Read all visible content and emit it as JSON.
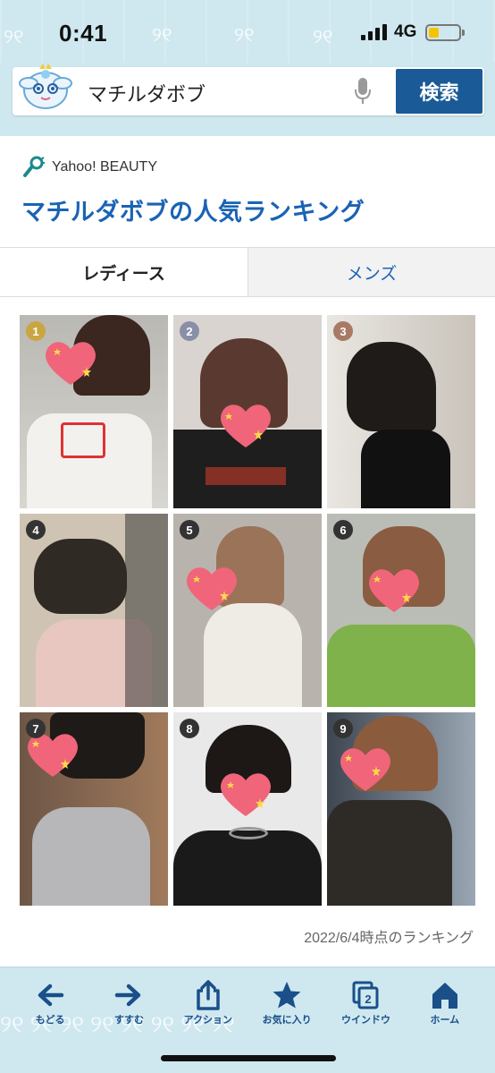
{
  "status_bar": {
    "time": "0:41",
    "network": "4G"
  },
  "search": {
    "query": "マチルダボブ",
    "button_label": "検索"
  },
  "header": {
    "brand": "Yahoo! BEAUTY",
    "title": "マチルダボブの人気ランキング"
  },
  "tabs": [
    {
      "label": "レディース",
      "selected": true
    },
    {
      "label": "メンズ",
      "selected": false
    }
  ],
  "ranking": {
    "items": [
      {
        "rank": "1",
        "badge_color": "#c9a640"
      },
      {
        "rank": "2",
        "badge_color": "#8a8fa8"
      },
      {
        "rank": "3",
        "badge_color": "#a87a66"
      },
      {
        "rank": "4",
        "badge_color": "#333333"
      },
      {
        "rank": "5",
        "badge_color": "#333333"
      },
      {
        "rank": "6",
        "badge_color": "#333333"
      },
      {
        "rank": "7",
        "badge_color": "#333333"
      },
      {
        "rank": "8",
        "badge_color": "#333333"
      },
      {
        "rank": "9",
        "badge_color": "#333333"
      }
    ],
    "date_note": "2022/6/4時点のランキング"
  },
  "bottom_nav": [
    {
      "label": "もどる",
      "icon": "back-arrow-icon"
    },
    {
      "label": "すすむ",
      "icon": "forward-arrow-icon"
    },
    {
      "label": "アクション",
      "icon": "share-icon"
    },
    {
      "label": "お気に入り",
      "icon": "star-icon"
    },
    {
      "label": "ウインドウ",
      "icon": "windows-icon",
      "count": "2"
    },
    {
      "label": "ホーム",
      "icon": "home-icon"
    }
  ],
  "colors": {
    "accent": "#1a63b5",
    "search_button": "#1a5a96",
    "theme_bg": "#cfe8ef",
    "heart": "#f0657a"
  }
}
